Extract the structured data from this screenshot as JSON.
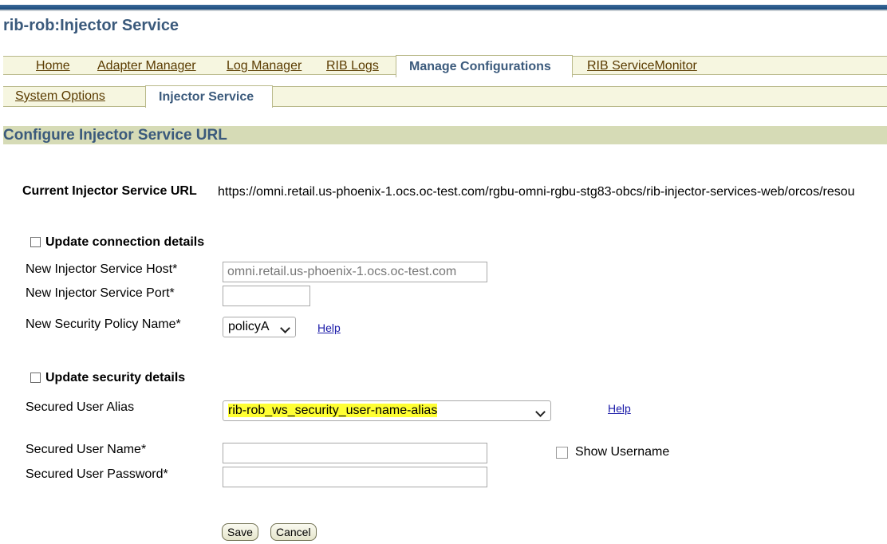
{
  "app": {
    "title": "rib-rob:Injector Service"
  },
  "tabs": [
    {
      "label": "Home"
    },
    {
      "label": "Adapter Manager"
    },
    {
      "label": "Log Manager"
    },
    {
      "label": "RIB Logs"
    },
    {
      "label": "Manage Configurations",
      "active": true
    },
    {
      "label": "RIB ServiceMonitor"
    }
  ],
  "subtabs": [
    {
      "label": "System Options"
    },
    {
      "label": "Injector Service",
      "active": true
    }
  ],
  "section": {
    "header": "Configure Injector Service URL"
  },
  "current_url": {
    "label": "Current Injector Service URL",
    "value": "https://omni.retail.us-phoenix-1.ocs.oc-test.com/rgbu-omni-rgbu-stg83-obcs/rib-injector-services-web/orcos/resou"
  },
  "connection": {
    "checkbox_label": "Update connection details",
    "host_label": "New Injector Service Host*",
    "host_placeholder": "omni.retail.us-phoenix-1.ocs.oc-test.com",
    "port_label": "New Injector Service Port*",
    "port_value": "",
    "policy_label": "New Security Policy Name*",
    "policy_value": "policyA",
    "help_label": "Help"
  },
  "security": {
    "checkbox_label": "Update security details",
    "alias_label": "Secured User Alias",
    "alias_value": "rib-rob_ws_security_user-name-alias",
    "help_label": "Help",
    "username_label": "Secured User Name*",
    "username_value": "",
    "show_username_label": "Show Username",
    "password_label": "Secured User Password*",
    "password_value": ""
  },
  "buttons": {
    "save": "Save",
    "cancel": "Cancel"
  },
  "colors": {
    "title": "#3b5a7c",
    "tab_bar": "#f6f6e0",
    "section_header": "#d6dbb6",
    "link": "#5a3b00",
    "help_link": "#1a1aa8",
    "alias_highlight": "#ffff33"
  }
}
